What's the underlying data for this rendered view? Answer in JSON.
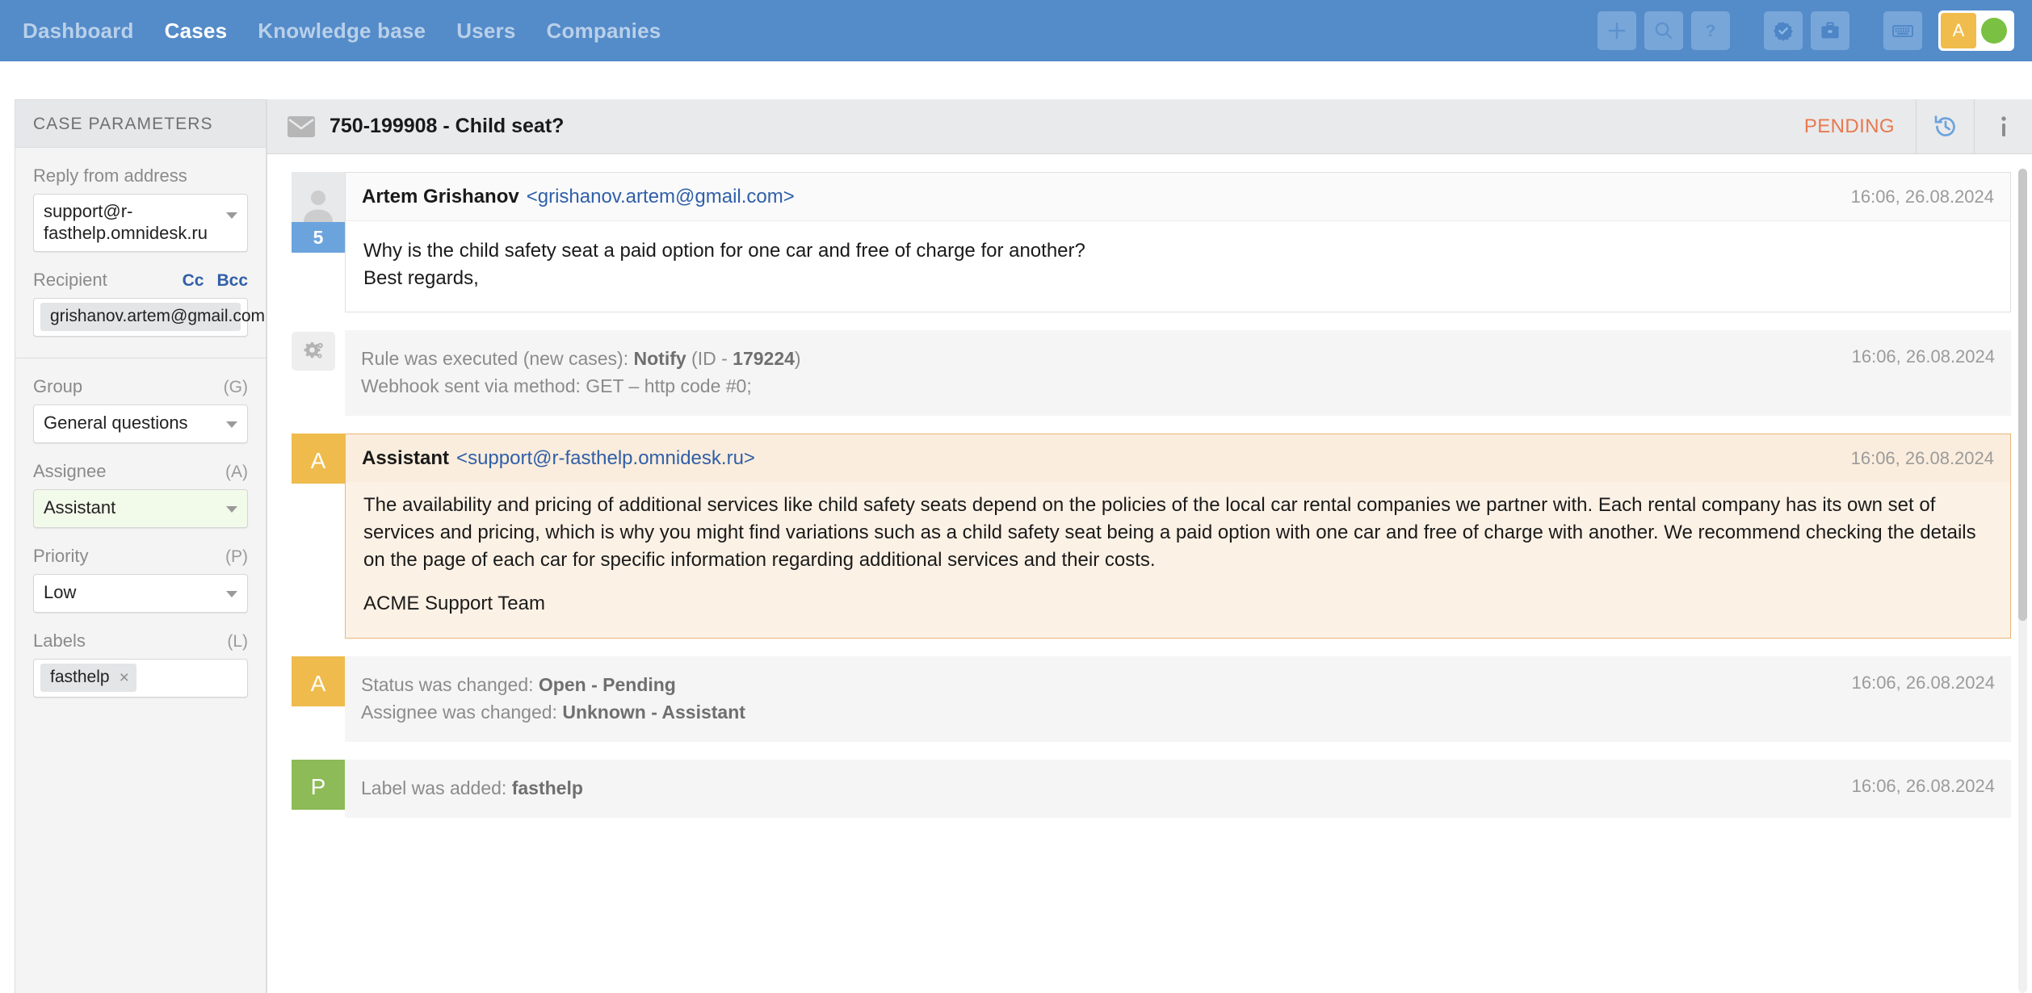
{
  "nav": {
    "links": [
      {
        "label": "Dashboard",
        "active": false
      },
      {
        "label": "Cases",
        "active": true
      },
      {
        "label": "Knowledge base",
        "active": false
      },
      {
        "label": "Users",
        "active": false
      },
      {
        "label": "Companies",
        "active": false
      }
    ],
    "actions": [
      {
        "name": "add-icon",
        "glyph": "+"
      },
      {
        "name": "search-icon",
        "glyph": "search"
      },
      {
        "name": "help-icon",
        "glyph": "?"
      },
      {
        "name": "badge-check-icon",
        "glyph": "badge"
      },
      {
        "name": "briefcase-icon",
        "glyph": "briefcase"
      },
      {
        "name": "keyboard-icon",
        "glyph": "keyboard"
      }
    ],
    "user": {
      "initial": "A",
      "status_color": "#7ac143"
    }
  },
  "sidebar": {
    "title": "CASE PARAMETERS",
    "reply_from": {
      "label": "Reply from address",
      "value": "support@r-fasthelp.omnidesk.ru"
    },
    "recipient": {
      "label": "Recipient",
      "cc_label": "Cc",
      "bcc_label": "Bcc",
      "tag": "grishanov.artem@gmail.com",
      "tag_remove": "×"
    },
    "group": {
      "label": "Group",
      "hint": "(G)",
      "value": "General questions"
    },
    "assignee": {
      "label": "Assignee",
      "hint": "(A)",
      "value": "Assistant"
    },
    "priority": {
      "label": "Priority",
      "hint": "(P)",
      "value": "Low"
    },
    "labels": {
      "label": "Labels",
      "hint": "(L)",
      "tag": "fasthelp",
      "tag_remove": "×"
    }
  },
  "case_header": {
    "icon": "envelope-icon",
    "title": "750-199908 - Child seat?",
    "status": "PENDING",
    "history_icon": "history-icon",
    "info_icon": "info-icon"
  },
  "thread": [
    {
      "kind": "message",
      "avatar_type": "photo",
      "badge": "5",
      "from": "Artem Grishanov",
      "email": "<grishanov.artem@gmail.com>",
      "time": "16:06, 26.08.2024",
      "paragraphs": [
        "Why is the child safety seat a paid option for one car and free of charge for another?\nBest regards,"
      ]
    },
    {
      "kind": "system",
      "avatar_type": "gear",
      "time": "16:06, 26.08.2024",
      "lines": [
        {
          "pre": "Rule was executed (new cases): ",
          "strong": "Notify",
          "mid": " (ID - ",
          "strong2": "179224",
          "post": ")"
        },
        {
          "pre": "Webhook sent via method: GET – http code #0;",
          "strong": "",
          "mid": "",
          "strong2": "",
          "post": ""
        }
      ]
    },
    {
      "kind": "message",
      "avatar_type": "letter",
      "avatar_letter": "A",
      "avatar_color": "yellow",
      "highlight": true,
      "from": "Assistant",
      "email": "<support@r-fasthelp.omnidesk.ru>",
      "time": "16:06, 26.08.2024",
      "paragraphs": [
        "The availability and pricing of additional services like child safety seats depend on the policies of the local car rental companies we partner with. Each rental company has its own set of services and pricing, which is why you might find variations such as a child safety seat being a paid option with one car and free of charge with another. We recommend checking the details on the page of each car for specific information regarding additional services and their costs.",
        "ACME Support Team"
      ]
    },
    {
      "kind": "system",
      "avatar_type": "letter",
      "avatar_letter": "A",
      "avatar_color": "yellow",
      "time": "16:06, 26.08.2024",
      "lines": [
        {
          "pre": "Status was changed: ",
          "strong": "Open - Pending",
          "mid": "",
          "strong2": "",
          "post": ""
        },
        {
          "pre": "Assignee was changed: ",
          "strong": "Unknown - Assistant",
          "mid": "",
          "strong2": "",
          "post": ""
        }
      ]
    },
    {
      "kind": "system",
      "avatar_type": "letter",
      "avatar_letter": "P",
      "avatar_color": "green",
      "time": "16:06, 26.08.2024",
      "lines": [
        {
          "pre": "Label was added: ",
          "strong": "fasthelp",
          "mid": "",
          "strong2": "",
          "post": ""
        }
      ]
    }
  ],
  "colors": {
    "nav_bg": "#548bc9",
    "accent_link": "#2f5fa8",
    "status_pending": "#e7794f",
    "avatar_yellow": "#efbb4c",
    "avatar_green": "#8cbb57",
    "badge_blue": "#6ba3dd",
    "highlight_bg": "#fcf1e5",
    "highlight_border": "#eab678"
  }
}
